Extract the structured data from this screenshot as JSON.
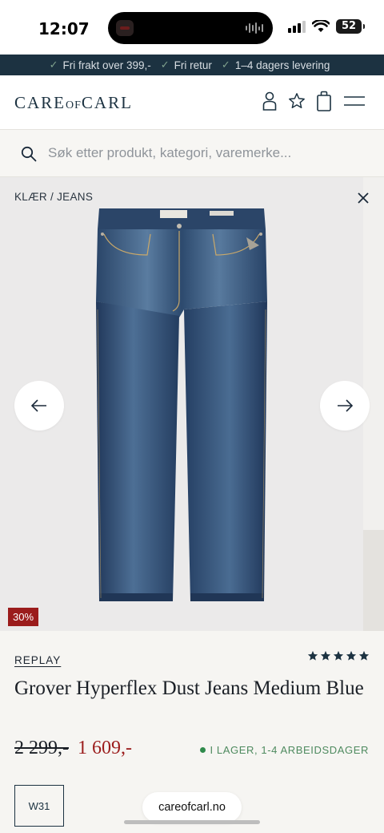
{
  "status_bar": {
    "time": "12:07",
    "battery": "52"
  },
  "promo": {
    "items": [
      "Fri frakt over 399,-",
      "Fri retur",
      "1–4 dagers levering"
    ]
  },
  "header": {
    "logo_left": "CARE",
    "logo_of": "OF",
    "logo_right": "CARL",
    "icons": [
      "user-icon",
      "star-icon",
      "bag-icon",
      "menu-icon"
    ]
  },
  "search": {
    "placeholder": "Søk etter produkt, kategori, varemerke..."
  },
  "gallery": {
    "breadcrumb": "KLÆR / JEANS",
    "discount": "30%"
  },
  "product": {
    "brand": "REPLAY",
    "title": "Grover Hyperflex Dust Jeans Medium Blue",
    "rating_stars": 5,
    "price_old": "2 299,-",
    "price_new": "1 609,-",
    "stock": "I LAGER, 1-4 ARBEIDSDAGER",
    "selected_size": "W31"
  },
  "browser": {
    "url": "careofcarl.no"
  },
  "colors": {
    "brand_navy": "#1c3241",
    "sale_red": "#9b1c1c",
    "stock_green": "#2f8a4b",
    "denim": "#2f4f77"
  }
}
